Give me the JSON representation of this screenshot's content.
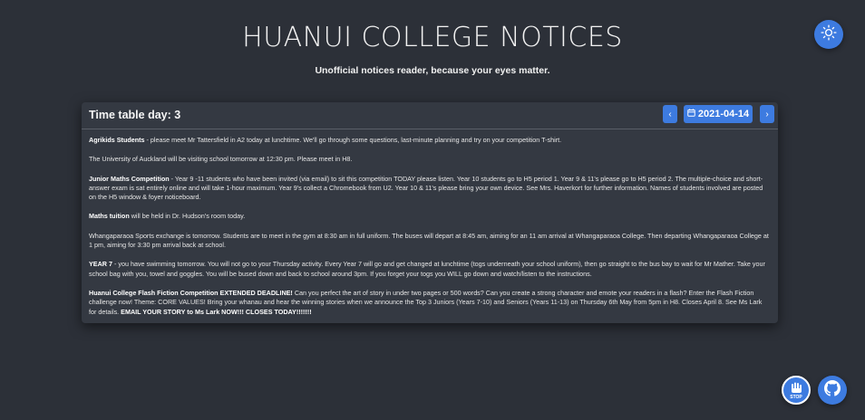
{
  "header": {
    "title": "HUANUI COLLEGE NOTICES",
    "subtitle": "Unofficial notices reader, because your eyes matter."
  },
  "toolbar": {
    "theme_icon": "sun-icon",
    "prev_icon": "chevron-left-icon",
    "next_icon": "chevron-right-icon",
    "calendar_icon": "calendar-icon",
    "date": "2021-04-14",
    "prev_label": "‹",
    "next_label": "›"
  },
  "card": {
    "day_label": "Time table day: 3"
  },
  "notices": [
    {
      "bold": "Agrikids Students",
      "text": " - please meet Mr Tattersfield in A2 today at lunchtime. We'll go through some questions, last-minute planning and try on your competition T-shirt."
    },
    {
      "bold": "",
      "text": "The University of Auckland will be visiting school tomorrow at 12:30 pm. Please meet in H8."
    },
    {
      "bold": "Junior Maths Competition",
      "text": " - Year 9 -11 students who have been invited (via email) to sit this competition TODAY please listen. Year 10 students go to H5 period 1. Year 9 & 11's please go to H5  period 2.  The multiple-choice and short-answer exam is sat entirely online and will take 1-hour maximum. Year 9's collect a Chromebook from U2. Year 10 & 11's please bring your own device. See Mrs. Haverkort for further information. Names of students involved are posted on the H5 window & foyer noticeboard."
    },
    {
      "bold": "Maths tuition",
      "text": " will be held in Dr. Hudson's room today."
    },
    {
      "bold": "",
      "text": "Whangaparaoa Sports exchange is tomorrow. Students are to meet in the gym at 8:30 am in full uniform.  The buses will depart at 8:45 am, aiming for an 11 am arrival at Whangaparaoa College.  Then departing Whangaparaoa College at 1 pm, aiming for 3:30 pm arrival back at school."
    },
    {
      "bold": "YEAR 7",
      "text": " - you have swimming tomorrow. You will not go to your Thursday activity. Every Year 7 will go and get changed at lunchtime (togs underneath your school uniform), then go straight to the bus bay to wait for Mr Mather. Take your school bag with you, towel and goggles. You will be bused down and back to school around 3pm. If you forget your togs you WILL go down and watch/listen to the instructions."
    },
    {
      "bold": "Huanui College Flash Fiction Competition EXTENDED DEADLINE!",
      "text": " Can you perfect the art of story in under two pages or 500 words? Can you create a strong character and emote your readers in a flash? Enter the Flash Fiction challenge now! Theme: CORE VALUES! Bring your whanau and hear the winning stories when we announce the Top 3 Juniors (Years 7-10) and Seniors (Years 11-13) on Thursday 6th May from 5pm in H8.  Closes April 8. See Ms Lark for details.  ",
      "bold_tail": "EMAIL YOUR STORY to Ms Lark NOW!!!  CLOSES TODAY!!!!!!!"
    }
  ],
  "footer": {
    "stop_label": "STOP",
    "stop_icon": "stop-hand-icon",
    "github_icon": "github-icon"
  },
  "colors": {
    "background": "#2c3038",
    "card": "#343942",
    "accent": "#3d7be0"
  }
}
